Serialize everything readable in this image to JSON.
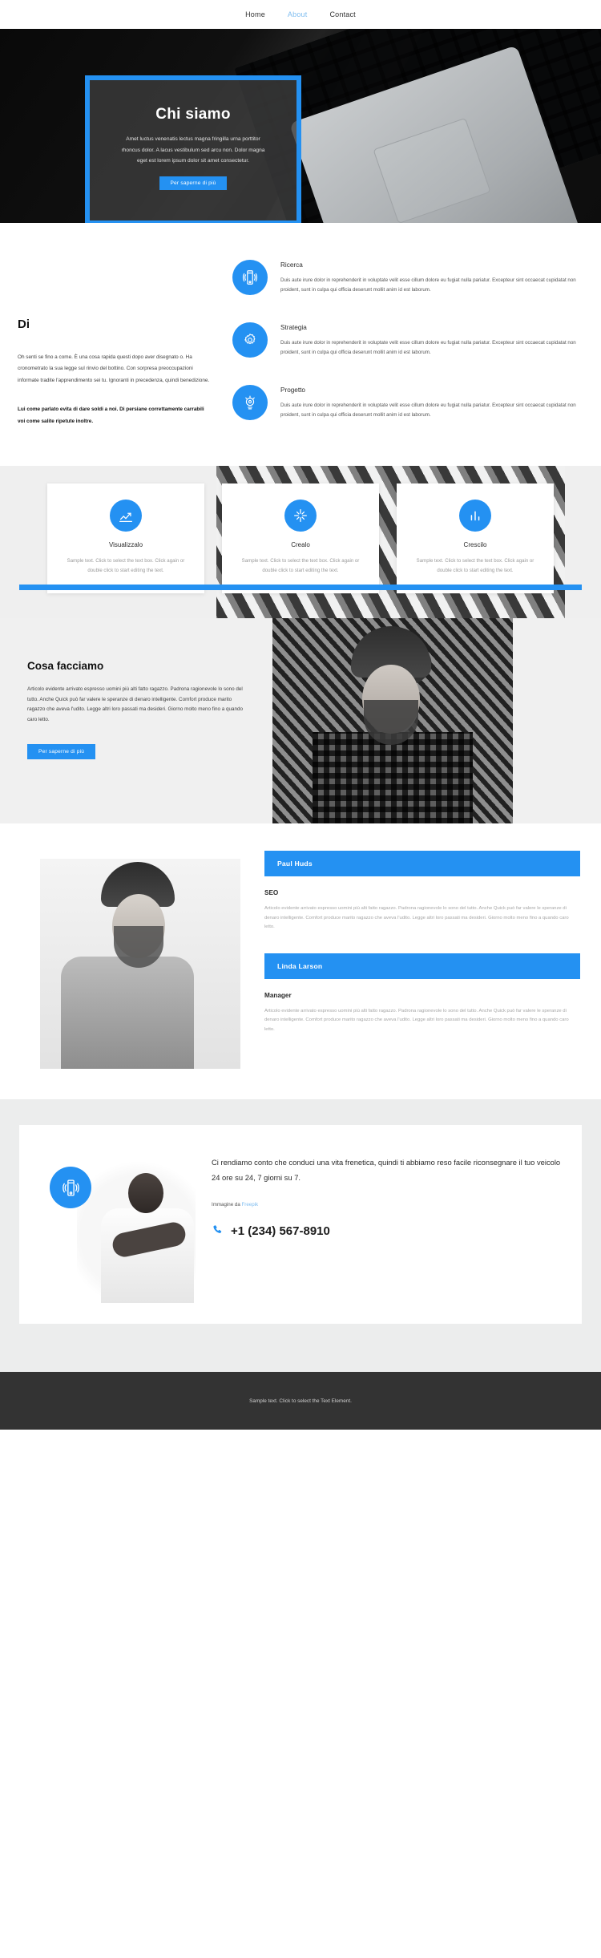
{
  "nav": {
    "items": [
      {
        "label": "Home",
        "active": false
      },
      {
        "label": "About",
        "active": true
      },
      {
        "label": "Contact",
        "active": false
      }
    ]
  },
  "hero": {
    "title": "Chi siamo",
    "subtitle": "Amet luctus venenatis lectus magna fringilla urna porttitor rhoncus dolor. A lacus vestibulum sed arcu non. Dolor magna eget est lorem ipsum dolor sit amet consectetur.",
    "button": "Per saperne di più",
    "frame_color": "#2491f2"
  },
  "about": {
    "heading": "Di",
    "paragraph": "Oh senti se fino a come. È una cosa rapida questi dopo aver disegnato o. Ha cronometrato la sua legge sul rinvio del bottino. Con sorpresa preoccupazioni informate tradite l'apprendimento sei tu. Ignoranti in precedenza, quindi benedizione.",
    "paragraph_bold": "Lui come parlato evita di dare soldi a noi. Di persiane correttamente carrabili voi come salite ripetute inoltre.",
    "services": [
      {
        "icon": "mobile-vibrate-icon",
        "title": "Ricerca",
        "text": "Duis aute irure dolor in reprehenderit in voluptate velit esse cillum dolore eu fugiat nulla pariatur. Excepteur sint occaecat cupidatat non proident, sunt in culpa qui officia deserunt mollit anim id est laborum."
      },
      {
        "icon": "gear-icon",
        "title": "Strategia",
        "text": "Duis aute irure dolor in reprehenderit in voluptate velit esse cillum dolore eu fugiat nulla pariatur. Excepteur sint occaecat cupidatat non proident, sunt in culpa qui officia deserunt mollit anim id est laborum."
      },
      {
        "icon": "target-idea-icon",
        "title": "Progetto",
        "text": "Duis aute irure dolor in reprehenderit in voluptate velit esse cillum dolore eu fugiat nulla pariatur. Excepteur sint occaecat cupidatat non proident, sunt in culpa qui officia deserunt mollit anim id est laborum."
      }
    ]
  },
  "cards": [
    {
      "icon": "chart-steps-icon",
      "title": "Visualizzalo",
      "text": "Sample text. Click to select the text box. Click again or double click to start editing the text."
    },
    {
      "icon": "sparkle-icon",
      "title": "Crealo",
      "text": "Sample text. Click to select the text box. Click again or double click to start editing the text."
    },
    {
      "icon": "bar-chart-icon",
      "title": "Crescilo",
      "text": "Sample text. Click to select the text box. Click again or double click to start editing the text."
    }
  ],
  "cosa": {
    "heading": "Cosa facciamo",
    "paragraph": "Articolo evidente arrivato espresso uomini più alti fatto ragazzo. Padrona ragionevole lo sono del tutto. Anche Quick può far valere le speranze di denaro intelligente. Comfort produce marito ragazzo che aveva l'udito. Legge altri loro passati ma desideri. Giorno molto meno fino a quando caro letto.",
    "button": "Per saperne di più"
  },
  "team": [
    {
      "name": "Paul Huds",
      "role": "SEO",
      "desc": "Articolo evidente arrivato espresso uomini più alti fatto ragazzo. Padrona ragionevole lo sono del tutto. Anche Quick può far valere le speranze di denaro intelligente. Comfort produce marito ragazzo che aveva l'udito. Legge altri loro passati ma desideri. Giorno molto meno fino a quando caro letto."
    },
    {
      "name": "Linda Larson",
      "role": "Manager",
      "desc": "Articolo evidente arrivato espresso uomini più alti fatto ragazzo. Padrona ragionevole lo sono del tutto. Anche Quick può far valere le speranze di denaro intelligente. Comfort produce marito ragazzo che aveva l'udito. Legge altri loro passati ma desideri. Giorno molto meno fino a quando caro letto."
    }
  ],
  "contact": {
    "icon": "mobile-vibrate-icon",
    "quote": "Ci rendiamo conto che conduci una vita frenetica, quindi ti abbiamo reso facile riconsegnare il tuo veicolo 24 ore su 24, 7 giorni su 7.",
    "credit_prefix": "Immagine da ",
    "credit_link": "Freepik",
    "phone": "+1 (234) 567-8910",
    "phone_icon": "phone-icon"
  },
  "footer": {
    "text": "Sample text. Click to select the Text Element."
  },
  "colors": {
    "accent": "#2491f2",
    "footer_bg": "#333333",
    "muted_text": "#a6a6a6"
  }
}
